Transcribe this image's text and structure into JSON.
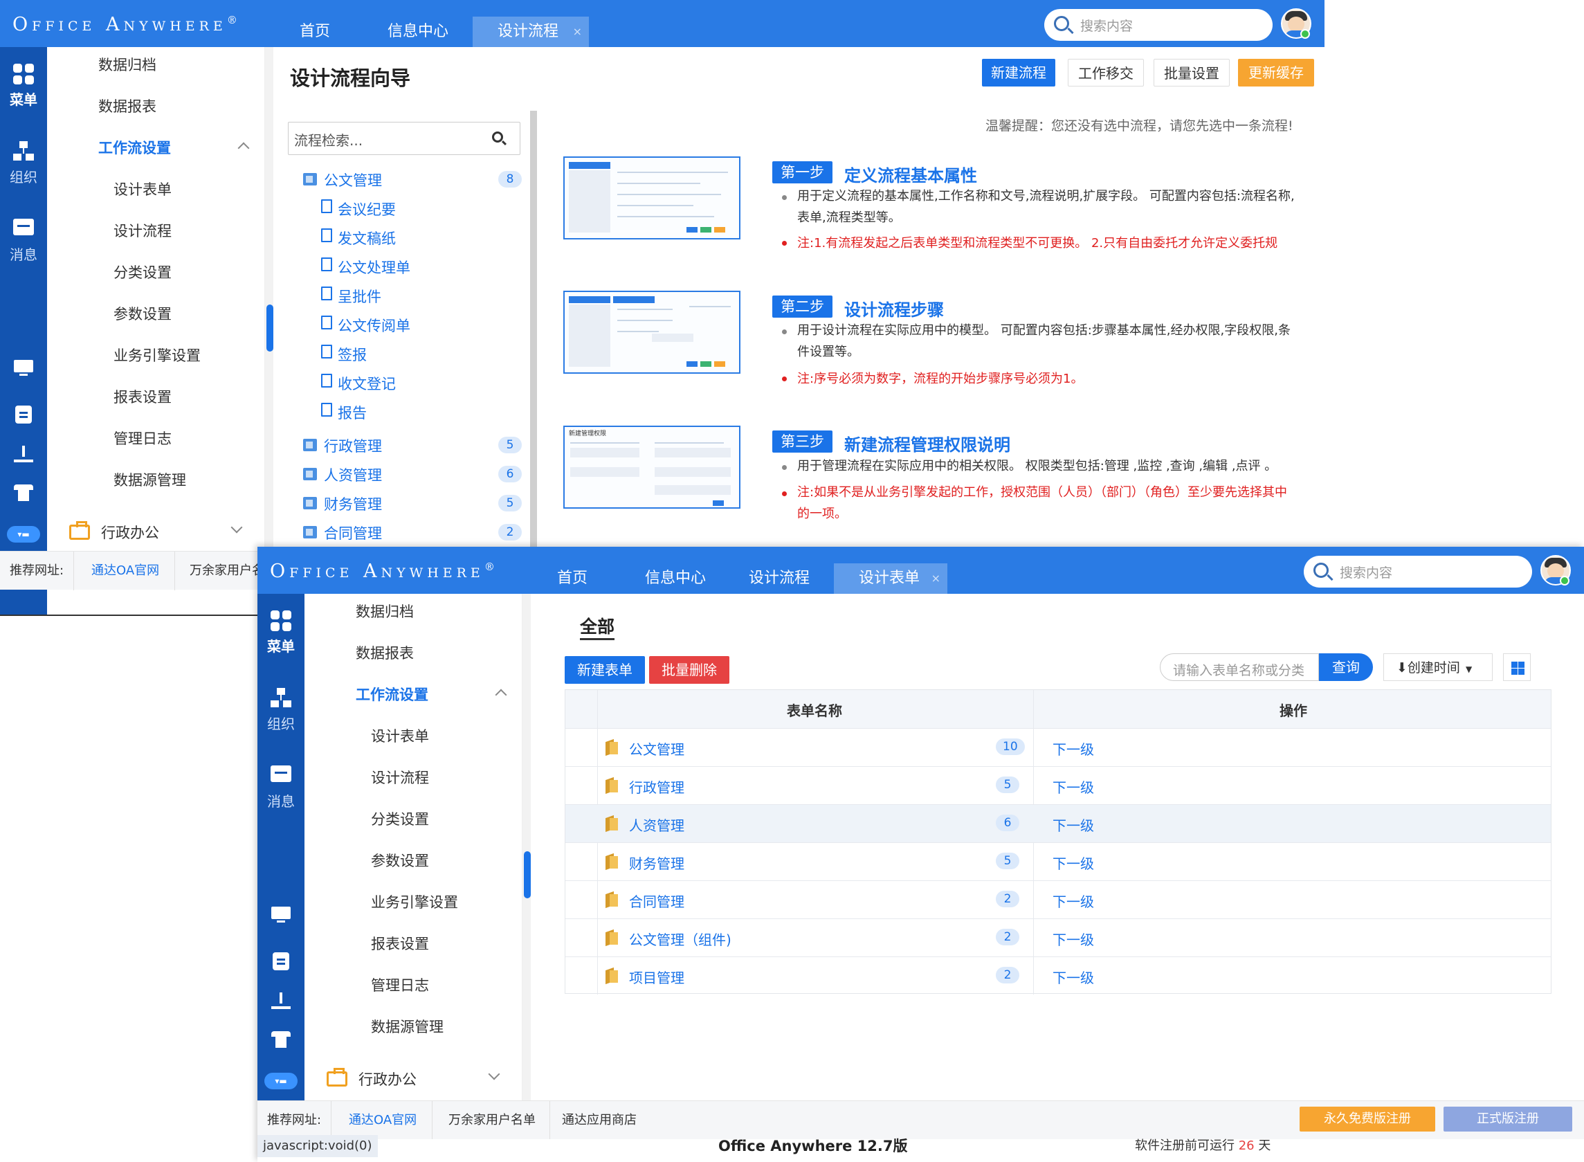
{
  "brand": {
    "logo": "Office Anywhere",
    "reg": "®"
  },
  "nav": {
    "home": "首页",
    "info": "信息中心",
    "flow": "设计流程",
    "form": "设计表单",
    "close": "×"
  },
  "search": {
    "placeholder": "搜索内容"
  },
  "rail": {
    "menu": "菜单",
    "org": "组织",
    "msg": "消息"
  },
  "menu": {
    "items": [
      "数据归档",
      "数据报表",
      "工作流设置",
      "设计表单",
      "设计流程",
      "分类设置",
      "参数设置",
      "业务引擎设置",
      "报表设置",
      "管理日志",
      "数据源管理"
    ],
    "admin": "行政办公"
  },
  "w1": {
    "title": "设计流程向导",
    "buttons": {
      "new": "新建流程",
      "transfer": "工作移交",
      "batch": "批量设置",
      "cache": "更新缓存"
    },
    "tree_search": "流程检索...",
    "tree": [
      {
        "label": "公文管理",
        "count": "8"
      },
      {
        "label": "会议纪要"
      },
      {
        "label": "发文稿纸"
      },
      {
        "label": "公文处理单"
      },
      {
        "label": "呈批件"
      },
      {
        "label": "公文传阅单"
      },
      {
        "label": "签报"
      },
      {
        "label": "收文登记"
      },
      {
        "label": "报告"
      },
      {
        "label": "行政管理",
        "count": "5"
      },
      {
        "label": "人资管理",
        "count": "6"
      },
      {
        "label": "财务管理",
        "count": "5"
      },
      {
        "label": "合同管理",
        "count": "2"
      }
    ],
    "hint": "温馨提醒：您还没有选中流程，请您先选中一条流程!",
    "steps": [
      {
        "tag": "第一步",
        "title": "定义流程基本属性",
        "desc": "用于定义流程的基本属性,工作名称和文号,流程说明,扩展字段。 可配置内容包括:流程名称,表单,流程类型等。",
        "note": "注:1.有流程发起之后表单类型和流程类型不可更换。 2.只有自由委托才允许定义委托规"
      },
      {
        "tag": "第二步",
        "title": "设计流程步骤",
        "desc": "用于设计流程在实际应用中的模型。 可配置内容包括:步骤基本属性,经办权限,字段权限,条件设置等。",
        "note": "注:序号必须为数字，流程的开始步骤序号必须为1。"
      },
      {
        "tag": "第三步",
        "title": "新建流程管理权限说明",
        "desc": "用于管理流程在实际应用中的相关权限。 权限类型包括:管理 ,监控 ,查询 ,编辑 ,点评 。",
        "note": "注:如果不是从业务引擎发起的工作，授权范围（人员）（部门）（角色）至少要先选择其中的一项。"
      }
    ],
    "step_img": {
      "t3": "新建管理权限"
    },
    "footer": {
      "label": "推荐网址:",
      "links": [
        "通达OA官网",
        "万余家用户名"
      ]
    }
  },
  "w2": {
    "all": "全部",
    "buttons": {
      "new": "新建表单",
      "del": "批量删除",
      "query": "查询",
      "sort": "创建时间"
    },
    "filter_placeholder": "请输入表单名称或分类",
    "cols": {
      "name": "表单名称",
      "op": "操作"
    },
    "rows": [
      {
        "name": "公文管理",
        "count": "10",
        "op": "下一级"
      },
      {
        "name": "行政管理",
        "count": "5",
        "op": "下一级"
      },
      {
        "name": "人资管理",
        "count": "6",
        "op": "下一级"
      },
      {
        "name": "财务管理",
        "count": "5",
        "op": "下一级"
      },
      {
        "name": "合同管理",
        "count": "2",
        "op": "下一级"
      },
      {
        "name": "公文管理（组件)",
        "count": "2",
        "op": "下一级"
      },
      {
        "name": "项目管理",
        "count": "2",
        "op": "下一级"
      }
    ],
    "footer": {
      "label": "推荐网址:",
      "links": [
        "通达OA官网",
        "万余家用户名单",
        "通达应用商店"
      ],
      "free": "永久免费版注册",
      "formal": "正式版注册"
    },
    "status": {
      "js": "javascript:void(0)",
      "version": "Office Anywhere 12.7版",
      "trial_pre": "软件注册前可运行",
      "days": "26",
      "trial_post": "天"
    }
  },
  "colors": {
    "brand": "#2a7be4",
    "rail": "#1354b0",
    "accent": "#1a73e8",
    "orange": "#f7a531",
    "red": "#e64242",
    "warn": "#e02020"
  }
}
